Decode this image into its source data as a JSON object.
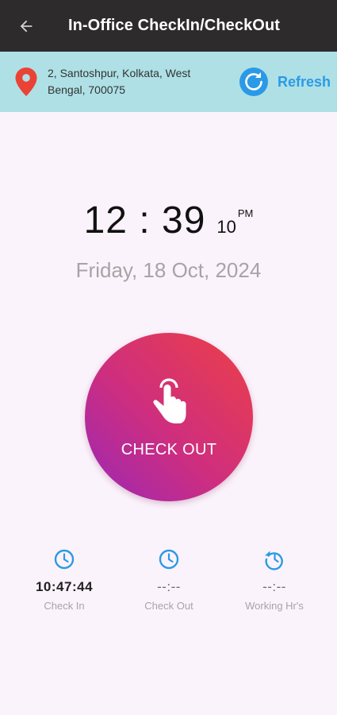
{
  "appbar": {
    "title": "In-Office CheckIn/CheckOut",
    "back_icon": "arrow-left-icon",
    "background": "#2d2b2b"
  },
  "location": {
    "icon": "map-pin-icon",
    "address": "2, Santoshpur, Kolkata, West Bengal, 700075",
    "refresh_label": "Refresh",
    "refresh_icon": "refresh-icon",
    "background": "#aee0e6",
    "accent": "#2b9ae6"
  },
  "clock": {
    "hours_minutes": "12 : 39",
    "seconds": "10",
    "ampm": "PM",
    "date": "Friday, 18 Oct, 2024"
  },
  "action": {
    "label": "CHECK OUT",
    "icon": "tap-hand-icon",
    "gradient": [
      "#9a28b6",
      "#cf2e7e",
      "#ec4046"
    ]
  },
  "stats": [
    {
      "icon": "clock-icon",
      "value": "10:47:44",
      "label": "Check In"
    },
    {
      "icon": "clock-icon",
      "value": "--:--",
      "label": "Check Out"
    },
    {
      "icon": "history-icon",
      "value": "--:--",
      "label": "Working Hr's"
    }
  ]
}
